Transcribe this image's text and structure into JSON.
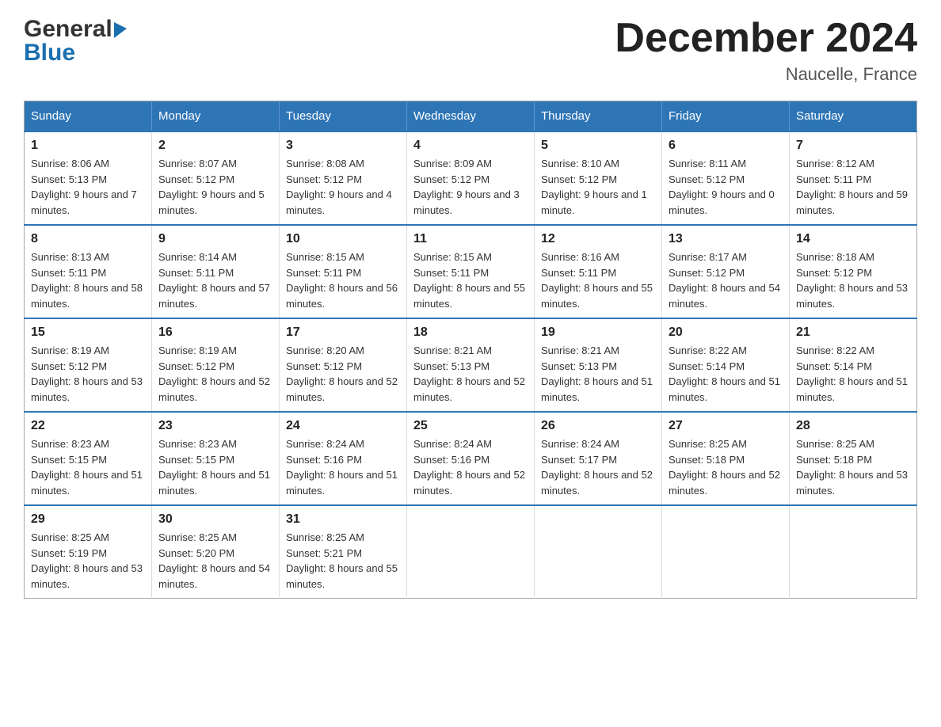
{
  "logo": {
    "general": "General",
    "arrow": "▶",
    "blue": "Blue"
  },
  "header": {
    "title": "December 2024",
    "location": "Naucelle, France"
  },
  "weekdays": [
    "Sunday",
    "Monday",
    "Tuesday",
    "Wednesday",
    "Thursday",
    "Friday",
    "Saturday"
  ],
  "weeks": [
    [
      {
        "day": "1",
        "sunrise": "8:06 AM",
        "sunset": "5:13 PM",
        "daylight": "9 hours and 7 minutes."
      },
      {
        "day": "2",
        "sunrise": "8:07 AM",
        "sunset": "5:12 PM",
        "daylight": "9 hours and 5 minutes."
      },
      {
        "day": "3",
        "sunrise": "8:08 AM",
        "sunset": "5:12 PM",
        "daylight": "9 hours and 4 minutes."
      },
      {
        "day": "4",
        "sunrise": "8:09 AM",
        "sunset": "5:12 PM",
        "daylight": "9 hours and 3 minutes."
      },
      {
        "day": "5",
        "sunrise": "8:10 AM",
        "sunset": "5:12 PM",
        "daylight": "9 hours and 1 minute."
      },
      {
        "day": "6",
        "sunrise": "8:11 AM",
        "sunset": "5:12 PM",
        "daylight": "9 hours and 0 minutes."
      },
      {
        "day": "7",
        "sunrise": "8:12 AM",
        "sunset": "5:11 PM",
        "daylight": "8 hours and 59 minutes."
      }
    ],
    [
      {
        "day": "8",
        "sunrise": "8:13 AM",
        "sunset": "5:11 PM",
        "daylight": "8 hours and 58 minutes."
      },
      {
        "day": "9",
        "sunrise": "8:14 AM",
        "sunset": "5:11 PM",
        "daylight": "8 hours and 57 minutes."
      },
      {
        "day": "10",
        "sunrise": "8:15 AM",
        "sunset": "5:11 PM",
        "daylight": "8 hours and 56 minutes."
      },
      {
        "day": "11",
        "sunrise": "8:15 AM",
        "sunset": "5:11 PM",
        "daylight": "8 hours and 55 minutes."
      },
      {
        "day": "12",
        "sunrise": "8:16 AM",
        "sunset": "5:11 PM",
        "daylight": "8 hours and 55 minutes."
      },
      {
        "day": "13",
        "sunrise": "8:17 AM",
        "sunset": "5:12 PM",
        "daylight": "8 hours and 54 minutes."
      },
      {
        "day": "14",
        "sunrise": "8:18 AM",
        "sunset": "5:12 PM",
        "daylight": "8 hours and 53 minutes."
      }
    ],
    [
      {
        "day": "15",
        "sunrise": "8:19 AM",
        "sunset": "5:12 PM",
        "daylight": "8 hours and 53 minutes."
      },
      {
        "day": "16",
        "sunrise": "8:19 AM",
        "sunset": "5:12 PM",
        "daylight": "8 hours and 52 minutes."
      },
      {
        "day": "17",
        "sunrise": "8:20 AM",
        "sunset": "5:12 PM",
        "daylight": "8 hours and 52 minutes."
      },
      {
        "day": "18",
        "sunrise": "8:21 AM",
        "sunset": "5:13 PM",
        "daylight": "8 hours and 52 minutes."
      },
      {
        "day": "19",
        "sunrise": "8:21 AM",
        "sunset": "5:13 PM",
        "daylight": "8 hours and 51 minutes."
      },
      {
        "day": "20",
        "sunrise": "8:22 AM",
        "sunset": "5:14 PM",
        "daylight": "8 hours and 51 minutes."
      },
      {
        "day": "21",
        "sunrise": "8:22 AM",
        "sunset": "5:14 PM",
        "daylight": "8 hours and 51 minutes."
      }
    ],
    [
      {
        "day": "22",
        "sunrise": "8:23 AM",
        "sunset": "5:15 PM",
        "daylight": "8 hours and 51 minutes."
      },
      {
        "day": "23",
        "sunrise": "8:23 AM",
        "sunset": "5:15 PM",
        "daylight": "8 hours and 51 minutes."
      },
      {
        "day": "24",
        "sunrise": "8:24 AM",
        "sunset": "5:16 PM",
        "daylight": "8 hours and 51 minutes."
      },
      {
        "day": "25",
        "sunrise": "8:24 AM",
        "sunset": "5:16 PM",
        "daylight": "8 hours and 52 minutes."
      },
      {
        "day": "26",
        "sunrise": "8:24 AM",
        "sunset": "5:17 PM",
        "daylight": "8 hours and 52 minutes."
      },
      {
        "day": "27",
        "sunrise": "8:25 AM",
        "sunset": "5:18 PM",
        "daylight": "8 hours and 52 minutes."
      },
      {
        "day": "28",
        "sunrise": "8:25 AM",
        "sunset": "5:18 PM",
        "daylight": "8 hours and 53 minutes."
      }
    ],
    [
      {
        "day": "29",
        "sunrise": "8:25 AM",
        "sunset": "5:19 PM",
        "daylight": "8 hours and 53 minutes."
      },
      {
        "day": "30",
        "sunrise": "8:25 AM",
        "sunset": "5:20 PM",
        "daylight": "8 hours and 54 minutes."
      },
      {
        "day": "31",
        "sunrise": "8:25 AM",
        "sunset": "5:21 PM",
        "daylight": "8 hours and 55 minutes."
      },
      null,
      null,
      null,
      null
    ]
  ]
}
